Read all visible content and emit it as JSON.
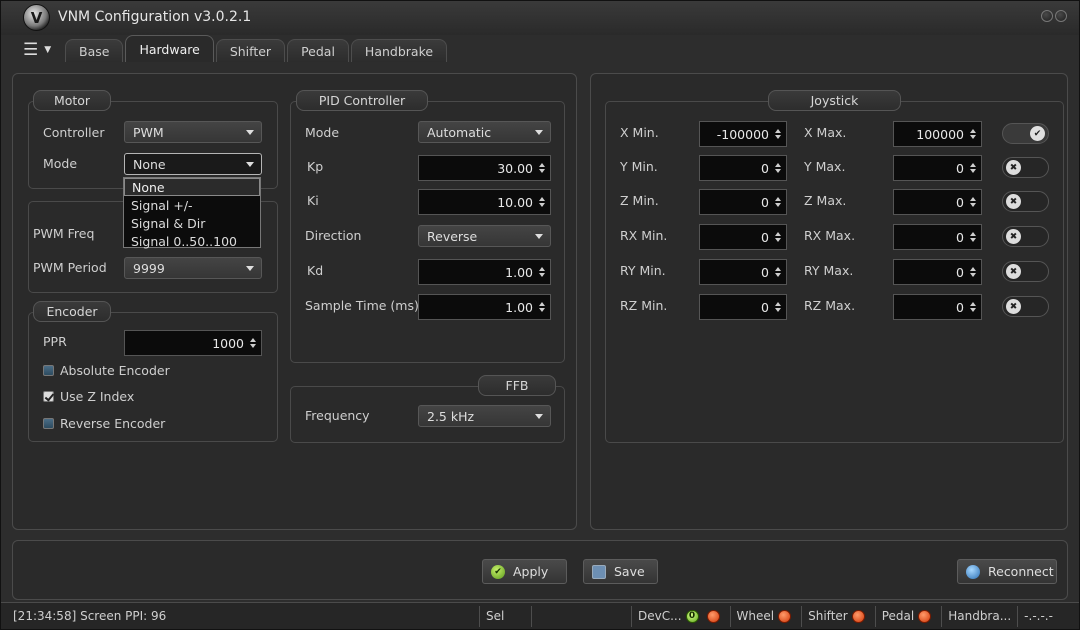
{
  "window": {
    "title": "VNM Configuration v3.0.2.1",
    "logo_letter": "V"
  },
  "tabs": [
    {
      "label": "Base",
      "active": false
    },
    {
      "label": "Hardware",
      "active": true
    },
    {
      "label": "Shifter",
      "active": false
    },
    {
      "label": "Pedal",
      "active": false
    },
    {
      "label": "Handbrake",
      "active": false
    }
  ],
  "motor": {
    "title": "Motor",
    "controller_label": "Controller",
    "controller_value": "PWM",
    "mode_label": "Mode",
    "mode_value": "None",
    "mode_options": [
      "None",
      "Signal +/-",
      "Signal & Dir",
      "Signal 0..50..100"
    ],
    "pwm_freq_label": "PWM Freq",
    "pwm_period_label": "PWM Period",
    "pwm_period_value": "9999"
  },
  "encoder": {
    "title": "Encoder",
    "ppr_label": "PPR",
    "ppr_value": "1000",
    "absolute_label": "Absolute Encoder",
    "absolute_checked": false,
    "use_z_label": "Use Z Index",
    "use_z_checked": true,
    "reverse_label": "Reverse Encoder",
    "reverse_checked": false
  },
  "pid": {
    "title": "PID Controller",
    "mode_label": "Mode",
    "mode_value": "Automatic",
    "kp_label": "Kp",
    "kp_value": "30.00",
    "ki_label": "Ki",
    "ki_value": "10.00",
    "direction_label": "Direction",
    "direction_value": "Reverse",
    "kd_label": "Kd",
    "kd_value": "1.00",
    "sample_label": "Sample Time (ms)",
    "sample_value": "1.00"
  },
  "ffb": {
    "title": "FFB",
    "frequency_label": "Frequency",
    "frequency_value": "2.5 kHz"
  },
  "joystick": {
    "title": "Joystick",
    "rows": [
      {
        "min_label": "X Min.",
        "min_value": "-100000",
        "max_label": "X Max.",
        "max_value": "100000",
        "enabled": true
      },
      {
        "min_label": "Y Min.",
        "min_value": "0",
        "max_label": "Y Max.",
        "max_value": "0",
        "enabled": false
      },
      {
        "min_label": "Z Min.",
        "min_value": "0",
        "max_label": "Z Max.",
        "max_value": "0",
        "enabled": false
      },
      {
        "min_label": "RX Min.",
        "min_value": "0",
        "max_label": "RX Max.",
        "max_value": "0",
        "enabled": false
      },
      {
        "min_label": "RY Min.",
        "min_value": "0",
        "max_label": "RY Max.",
        "max_value": "0",
        "enabled": false
      },
      {
        "min_label": "RZ Min.",
        "min_value": "0",
        "max_label": "RZ Max.",
        "max_value": "0",
        "enabled": false
      }
    ]
  },
  "buttons": {
    "apply": "Apply",
    "save": "Save",
    "reconnect": "Reconnect"
  },
  "status": {
    "log": "[21:34:58] Screen PPI: 96",
    "sel": "Sel",
    "dev": "DevC...",
    "dev_count": "0",
    "wheel": "Wheel",
    "shifter": "Shifter",
    "pedal": "Pedal",
    "handbrake": "Handbra...",
    "tail": "-.-.-.-"
  },
  "colors": {
    "background": "#2d2d2d",
    "status_led_red": "#d23a0a",
    "status_led_green": "#5ea51c"
  }
}
